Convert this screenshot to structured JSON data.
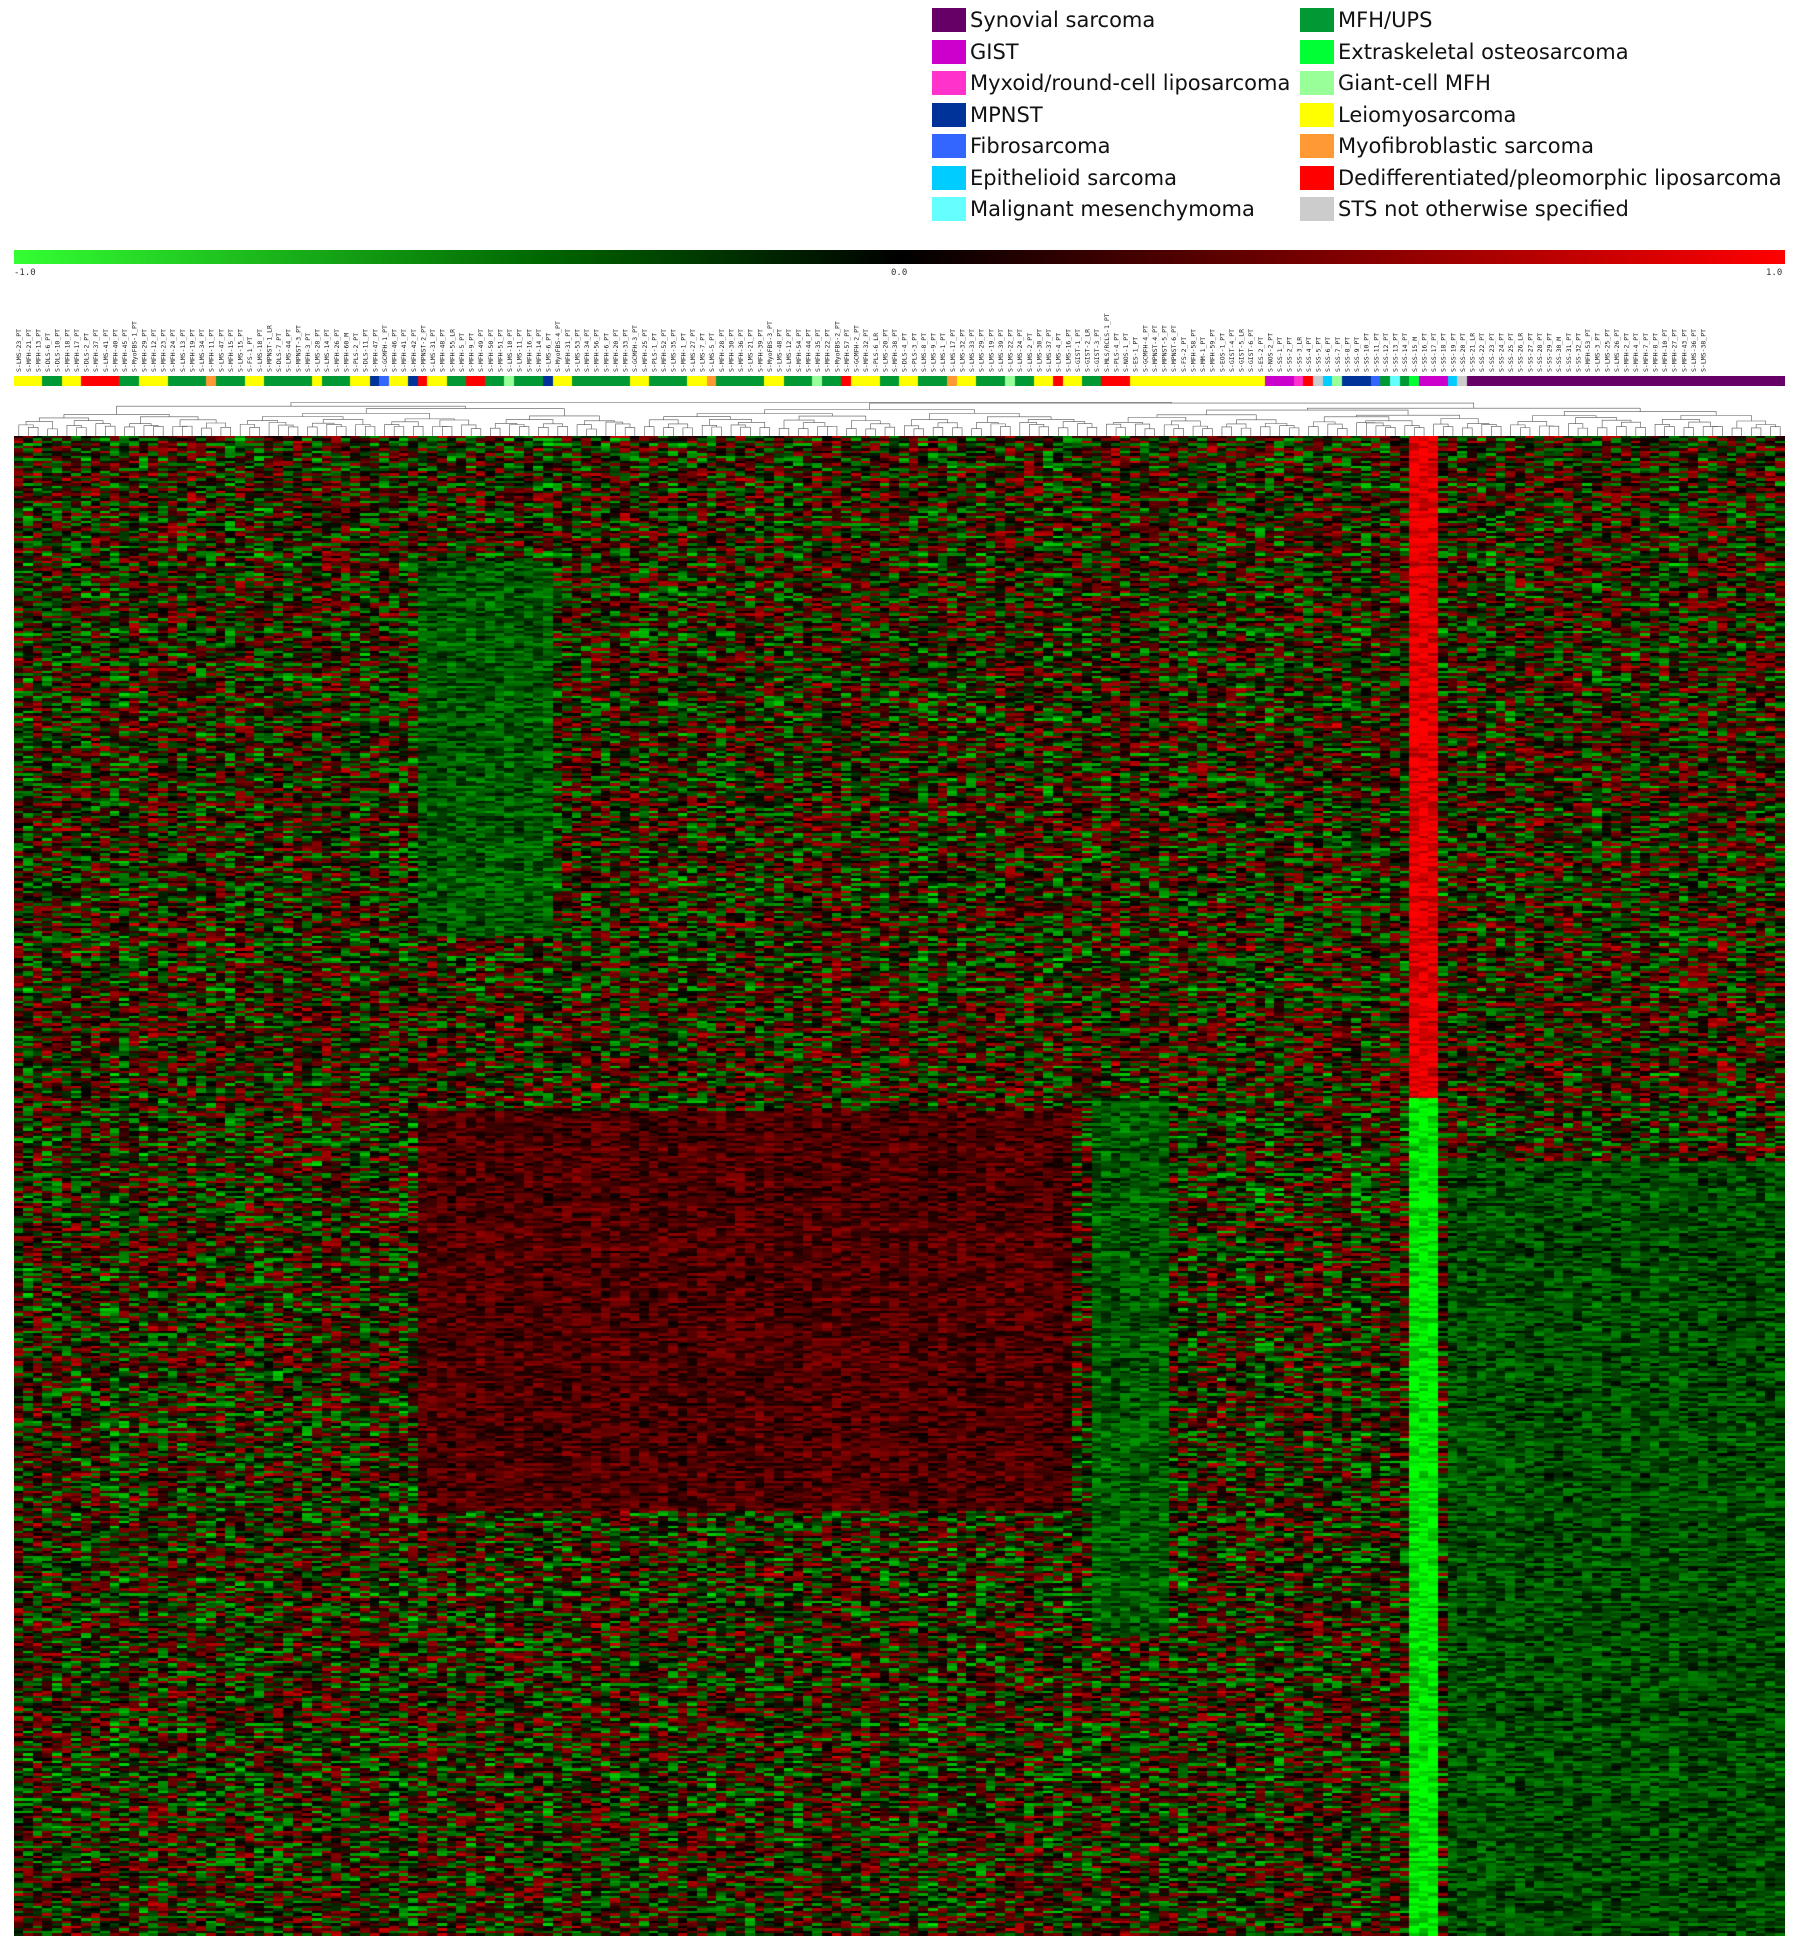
{
  "legend": [
    {
      "label": "Synovial sarcoma",
      "color": "#660066"
    },
    {
      "label": "GIST",
      "color": "#cc00cc"
    },
    {
      "label": "Myxoid/round-cell liposarcoma",
      "color": "#ff33cc"
    },
    {
      "label": "MPNST",
      "color": "#003399"
    },
    {
      "label": "Fibrosarcoma",
      "color": "#3366ff"
    },
    {
      "label": "Epithelioid sarcoma",
      "color": "#00ccff"
    },
    {
      "label": "Malignant mesenchymoma",
      "color": "#66ffff"
    },
    {
      "label": "MFH/UPS",
      "color": "#009933"
    },
    {
      "label": "Extraskeletal osteosarcoma",
      "color": "#00ff33"
    },
    {
      "label": "Giant-cell MFH",
      "color": "#99ff99"
    },
    {
      "label": "Leiomyosarcoma",
      "color": "#ffff00"
    },
    {
      "label": "Myofibroblastic sarcoma",
      "color": "#ff9933"
    },
    {
      "label": "Dedifferentiated/pleomorphic liposarcoma",
      "color": "#ff0000"
    },
    {
      "label": "STS not otherwise specified",
      "color": "#cccccc"
    }
  ],
  "chart_data": {
    "type": "heatmap",
    "color_scale": {
      "min": -1.0,
      "mid": 0.0,
      "max": 1.0,
      "tick_labels": [
        "-1.0",
        "0.0",
        "1.0"
      ],
      "colors": [
        "#33ff33",
        "#000000",
        "#ff0000"
      ]
    },
    "n_samples": 184,
    "n_genes": 600,
    "class_annotation_groups": [
      {
        "class": "Leiomyosarcoma",
        "count": 3
      },
      {
        "class": "MFH/UPS",
        "count": 2
      },
      {
        "class": "Leiomyosarcoma",
        "count": 2
      },
      {
        "class": "Dedifferentiated/pleomorphic liposarcoma",
        "count": 4
      },
      {
        "class": "MFH/UPS",
        "count": 2
      },
      {
        "class": "Leiomyosarcoma",
        "count": 3
      },
      {
        "class": "MFH/UPS",
        "count": 4
      },
      {
        "class": "Myofibroblastic sarcoma",
        "count": 1
      },
      {
        "class": "MFH/UPS",
        "count": 3
      },
      {
        "class": "Leiomyosarcoma",
        "count": 2
      },
      {
        "class": "MFH/UPS",
        "count": 5
      },
      {
        "class": "Leiomyosarcoma",
        "count": 1
      },
      {
        "class": "MFH/UPS",
        "count": 3
      },
      {
        "class": "Leiomyosarcoma",
        "count": 2
      },
      {
        "class": "MPNST",
        "count": 1
      },
      {
        "class": "Fibrosarcoma",
        "count": 1
      },
      {
        "class": "Leiomyosarcoma",
        "count": 2
      },
      {
        "class": "MPNST",
        "count": 1
      },
      {
        "class": "Dedifferentiated/pleomorphic liposarcoma",
        "count": 1
      },
      {
        "class": "Leiomyosarcoma",
        "count": 2
      },
      {
        "class": "MFH/UPS",
        "count": 2
      },
      {
        "class": "Dedifferentiated/pleomorphic liposarcoma",
        "count": 2
      },
      {
        "class": "MFH/UPS",
        "count": 2
      },
      {
        "class": "Giant-cell MFH",
        "count": 1
      },
      {
        "class": "MFH/UPS",
        "count": 3
      },
      {
        "class": "MPNST",
        "count": 1
      },
      {
        "class": "Leiomyosarcoma",
        "count": 2
      },
      {
        "class": "MFH/UPS",
        "count": 6
      },
      {
        "class": "Leiomyosarcoma",
        "count": 2
      },
      {
        "class": "MFH/UPS",
        "count": 4
      },
      {
        "class": "Leiomyosarcoma",
        "count": 2
      },
      {
        "class": "Myofibroblastic sarcoma",
        "count": 1
      },
      {
        "class": "MFH/UPS",
        "count": 5
      },
      {
        "class": "Leiomyosarcoma",
        "count": 2
      },
      {
        "class": "MFH/UPS",
        "count": 3
      },
      {
        "class": "Giant-cell MFH",
        "count": 1
      },
      {
        "class": "MFH/UPS",
        "count": 2
      },
      {
        "class": "Dedifferentiated/pleomorphic liposarcoma",
        "count": 1
      },
      {
        "class": "Leiomyosarcoma",
        "count": 3
      },
      {
        "class": "MFH/UPS",
        "count": 2
      },
      {
        "class": "Leiomyosarcoma",
        "count": 2
      },
      {
        "class": "MFH/UPS",
        "count": 3
      },
      {
        "class": "Myofibroblastic sarcoma",
        "count": 1
      },
      {
        "class": "Leiomyosarcoma",
        "count": 2
      },
      {
        "class": "MFH/UPS",
        "count": 3
      },
      {
        "class": "Giant-cell MFH",
        "count": 1
      },
      {
        "class": "MFH/UPS",
        "count": 2
      },
      {
        "class": "Leiomyosarcoma",
        "count": 2
      },
      {
        "class": "Dedifferentiated/pleomorphic liposarcoma",
        "count": 1
      },
      {
        "class": "Leiomyosarcoma",
        "count": 2
      },
      {
        "class": "MFH/UPS",
        "count": 2
      },
      {
        "class": "Dedifferentiated/pleomorphic liposarcoma",
        "count": 3
      },
      {
        "class": "Leiomyosarcoma",
        "count": 14
      },
      {
        "class": "GIST",
        "count": 3
      },
      {
        "class": "Myxoid/round-cell liposarcoma",
        "count": 1
      },
      {
        "class": "Dedifferentiated/pleomorphic liposarcoma",
        "count": 1
      },
      {
        "class": "STS not otherwise specified",
        "count": 1
      },
      {
        "class": "Epithelioid sarcoma",
        "count": 1
      },
      {
        "class": "Giant-cell MFH",
        "count": 1
      },
      {
        "class": "MPNST",
        "count": 3
      },
      {
        "class": "Fibrosarcoma",
        "count": 1
      },
      {
        "class": "MFH/UPS",
        "count": 1
      },
      {
        "class": "Malignant mesenchymoma",
        "count": 1
      },
      {
        "class": "MFH/UPS",
        "count": 1
      },
      {
        "class": "Extraskeletal osteosarcoma",
        "count": 1
      },
      {
        "class": "GIST",
        "count": 3
      },
      {
        "class": "Epithelioid sarcoma",
        "count": 1
      },
      {
        "class": "STS not otherwise specified",
        "count": 1
      },
      {
        "class": "Synovial sarcoma",
        "count": 32
      }
    ],
    "sample_labels": [
      "S-LMS-23_PT",
      "S-MFH-21_PT",
      "S-MFH-13_PT",
      "S-DLS-6_PT",
      "S-DLS-10_PT",
      "S-MFH-18_PT",
      "S-MFH-17_PT",
      "S-DLS-2_PT",
      "S-MFH-37_PT",
      "S-LMS-41_PT",
      "S-MFH-40_PT",
      "S-MFH-45_PT",
      "S-MyoFBS-1_PT",
      "S-MFH-29_PT",
      "S-MFH-12_PT",
      "S-MFH-23_PT",
      "S-MFH-24_PT",
      "S-LMS-13_PT",
      "S-MFH-19_PT",
      "S-LMS-34_PT",
      "S-MFH-11_PT",
      "S-LMS-47_PT",
      "S-MFH-15_PT",
      "S-LMS-15_PT",
      "S-FS-1_PT",
      "S-LMS-18_PT",
      "S-MPNST-1_LR",
      "S-DLS-7_PT",
      "S-LMS-44_PT",
      "S-MPNST-3_PT",
      "S-MFH-3_PT",
      "S-LMS-28_PT",
      "S-LMS-14_PT",
      "S-MFH-26_PT",
      "S-MFH-60_M",
      "S-PLS-2_PT",
      "S-DLS-11_PT",
      "S-MFH-47_PT",
      "S-GCMFH-1_PT",
      "S-MFH-46_PT",
      "S-MFH-41_PT",
      "S-MFH-42_PT",
      "S-MPNST-2_PT",
      "S-LMS-31_PT",
      "S-MFH-48_PT",
      "S-MFH-55_LR",
      "S-MFH-5_PT",
      "S-MFH-9_PT",
      "S-MFH-49_PT",
      "S-MFH-50_PT",
      "S-MFH-51_PT",
      "S-LMS-10_PT",
      "S-LMS-11_PT",
      "S-MFH-16_PT",
      "S-MFH-14_PT",
      "S-LMS-6_PT",
      "S-MyoFBS-4_PT",
      "S-MFH-31_PT",
      "S-LMS-53_PT",
      "S-MFH-34_PT",
      "S-MFH-56_PT",
      "S-MFH-6_PT",
      "S-MFH-20_PT",
      "S-MFH-33_PT",
      "S-GCMFH-3_PT",
      "S-MFH-25_PT",
      "S-PLS-1_PT",
      "S-MFH-52_PT",
      "S-LMS-35_PT",
      "S-MFH-1_PT",
      "S-LMS-27_PT",
      "S-LMS-7_PT",
      "S-LMS-5_PT",
      "S-MFH-28_PT",
      "S-MFH-30_PT",
      "S-MFH-36_PT",
      "S-LMS-21_PT",
      "S-MFH-39_PT",
      "S-MyoFBS-3_PT",
      "S-LMS-48_PT",
      "S-LMS-12_PT",
      "S-MFH-54_PT",
      "S-MFH-44_PT",
      "S-MFH-35_PT",
      "S-MFH-22_PT",
      "S-MyoFBS-2_PT",
      "S-MFH-57_PT",
      "S-GCMFH-2_PT",
      "S-MFH-32_PT",
      "S-PLS-6_LR",
      "S-LMS-20_PT",
      "S-MFH-38_PT",
      "S-DLS-4_PT",
      "S-PLS-3_PT",
      "S-LMS-8_PT",
      "S-LMS-9_PT",
      "S-LMS-1_PT",
      "S-LMS-17_PT",
      "S-LMS-32_PT",
      "S-LMS-33_PT",
      "S-LMS-29_PT",
      "S-LMS-19_PT",
      "S-LMS-39_PT",
      "S-LMS-22_PT",
      "S-LMS-24_PT",
      "S-LMS-2_PT",
      "S-LMS-30_PT",
      "S-LMS-37_PT",
      "S-LMS-4_PT",
      "S-LMS-16_PT",
      "S-GIST-1_PT",
      "S-GIST-2_LR",
      "S-GIST-3_PT",
      "S-MLS/RCLS-1_PT",
      "S-PLS-4_PT",
      "S-NOS-1_PT",
      "S-ES-1_PT",
      "S-GCMFH-4_PT",
      "S-MPNST-4_PT",
      "S-MPNST-5_PT",
      "S-MPNST-6_PT",
      "S-FS-2_PT",
      "S-MFH-58_PT",
      "S-MM-1_PT",
      "S-MFH-59_PT",
      "S-EOS-1_PT",
      "S-GIST-4_PT",
      "S-GIST-5_LR",
      "S-GIST-6_PT",
      "S-ES-2_PT",
      "S-NOS-2_PT",
      "S-SS-1_PT",
      "S-SS-2_PT",
      "S-SS-3_LR",
      "S-SS-4_PT",
      "S-SS-5_PT",
      "S-SS-6_PT",
      "S-SS-7_PT",
      "S-SS-8_PT",
      "S-SS-9_PT",
      "S-SS-10_PT",
      "S-SS-11_PT",
      "S-SS-12_PT",
      "S-SS-13_PT",
      "S-SS-14_PT",
      "S-SS-15_M",
      "S-SS-16_PT",
      "S-SS-17_PT",
      "S-SS-18_PT",
      "S-SS-19_PT",
      "S-SS-20_PT",
      "S-SS-21_LR",
      "S-SS-22_PT",
      "S-SS-23_PT",
      "S-SS-24_PT",
      "S-SS-25_PT",
      "S-SS-26_LR",
      "S-SS-27_PT",
      "S-SS-28_PT",
      "S-SS-29_PT",
      "S-SS-30_M",
      "S-SS-31_PT",
      "S-SS-32_PT",
      "S-MFH-53_PT",
      "S-LMS-3_PT",
      "S-LMS-25_PT",
      "S-LMS-26_PT",
      "S-MFH-2_PT",
      "S-MFH-4_PT",
      "S-MFH-7_PT",
      "S-MFH-8_PT",
      "S-MFH-10_PT",
      "S-MFH-27_PT",
      "S-MFH-43_PT",
      "S-LMS-36_PT",
      "S-LMS-38_PT"
    ],
    "block_features": [
      {
        "samples": [
          145,
          148
        ],
        "genes": [
          0,
          265
        ],
        "value": 0.9
      },
      {
        "samples": [
          145,
          148
        ],
        "genes": [
          265,
          600
        ],
        "value": -0.9
      },
      {
        "samples": [
          112,
          120
        ],
        "genes": [
          265,
          480
        ],
        "value": -0.35
      },
      {
        "samples": [
          42,
          56
        ],
        "genes": [
          50,
          200
        ],
        "value": -0.35
      },
      {
        "samples": [
          42,
          110
        ],
        "genes": [
          270,
          430
        ],
        "value": 0.3
      },
      {
        "samples": [
          149,
          184
        ],
        "genes": [
          290,
          600
        ],
        "value": -0.3
      }
    ]
  }
}
